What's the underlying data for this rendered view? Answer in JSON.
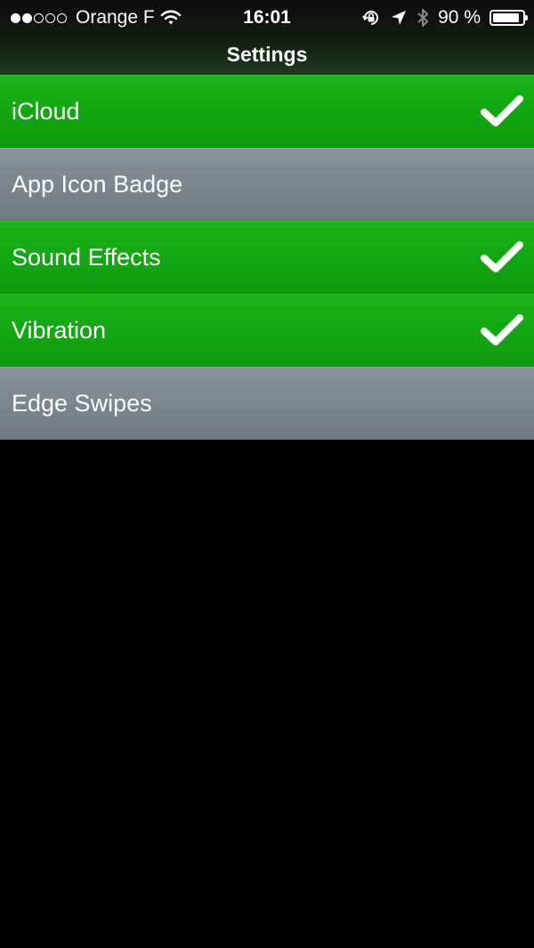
{
  "status_bar": {
    "carrier": "Orange F",
    "signal_bars_filled": 2,
    "signal_bars_total": 5,
    "time": "16:01",
    "battery_text": "90 %",
    "battery_level": 0.9,
    "icons": [
      "wifi-icon",
      "rotation-lock-icon",
      "location-arrow-icon",
      "bluetooth-icon",
      "battery-icon"
    ]
  },
  "nav": {
    "title": "Settings"
  },
  "settings": [
    {
      "label": "iCloud",
      "enabled": true
    },
    {
      "label": "App Icon Badge",
      "enabled": false
    },
    {
      "label": "Sound Effects",
      "enabled": true
    },
    {
      "label": "Vibration",
      "enabled": true
    },
    {
      "label": "Edge Swipes",
      "enabled": false
    }
  ],
  "colors": {
    "enabled_row": "#14a814",
    "disabled_row": "#7c848e",
    "background": "#000000"
  }
}
